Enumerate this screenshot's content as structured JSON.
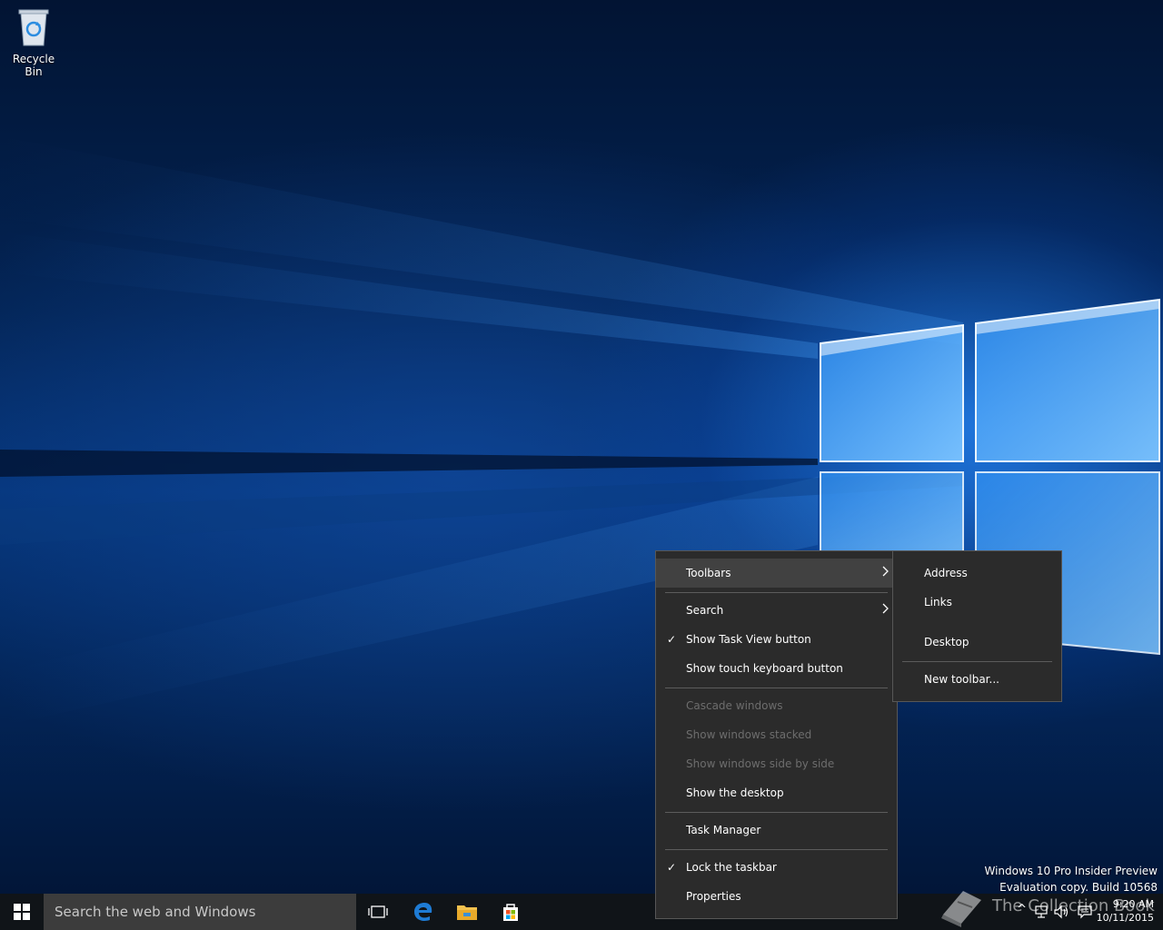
{
  "desktop": {
    "recycle_bin_label": "Recycle Bin",
    "watermark_line1": "Windows 10 Pro Insider Preview",
    "watermark_line2": "Evaluation copy. Build 10568",
    "overlay_text": "The Collection Book"
  },
  "context_menu": {
    "items": [
      {
        "label": "Toolbars",
        "submenu": true,
        "highlighted": true
      },
      {
        "label": "Search",
        "submenu": true
      },
      {
        "label": "Show Task View button",
        "checked": true
      },
      {
        "label": "Show touch keyboard button"
      },
      {
        "label": "Cascade windows",
        "disabled": true
      },
      {
        "label": "Show windows stacked",
        "disabled": true
      },
      {
        "label": "Show windows side by side",
        "disabled": true
      },
      {
        "label": "Show the desktop"
      },
      {
        "label": "Task Manager"
      },
      {
        "label": "Lock the taskbar",
        "checked": true
      },
      {
        "label": "Properties"
      }
    ]
  },
  "toolbars_submenu": {
    "items": [
      {
        "label": "Address"
      },
      {
        "label": "Links"
      },
      {
        "label": "Desktop"
      },
      {
        "label": "New toolbar..."
      }
    ]
  },
  "taskbar": {
    "search_placeholder": "Search the web and Windows",
    "pinned": [
      "task-view-icon",
      "edge-icon",
      "file-explorer-icon",
      "store-icon"
    ],
    "clock_time": "9:20 AM",
    "clock_date": "10/11/2015"
  },
  "colors": {
    "menu_bg": "#2b2b2b",
    "menu_highlight": "#414141",
    "taskbar_bg": "#101418",
    "search_bg": "#3c3c3c",
    "edge_blue": "#1e7bd4"
  }
}
